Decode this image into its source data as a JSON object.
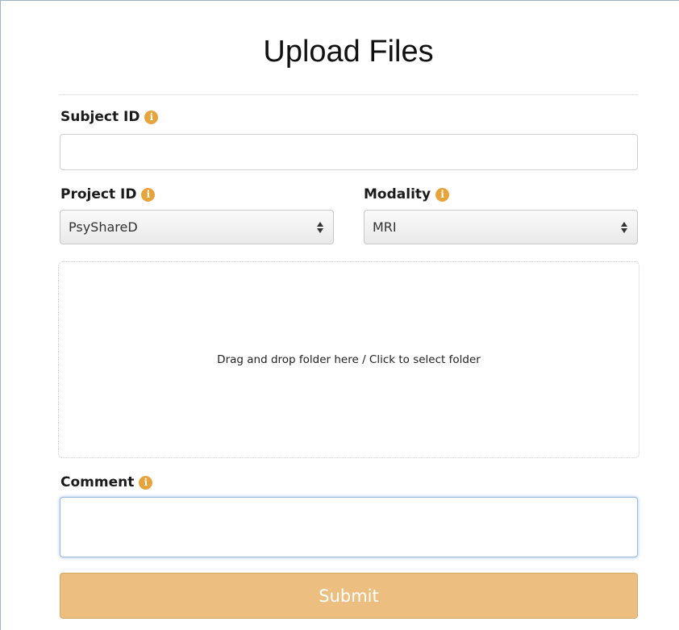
{
  "form": {
    "title": "Upload Files",
    "subject_id": {
      "label": "Subject ID",
      "value": ""
    },
    "project_id": {
      "label": "Project ID",
      "selected": "PsyShareD"
    },
    "modality": {
      "label": "Modality",
      "selected": "MRI"
    },
    "dropzone": {
      "text": "Drag and drop folder here / Click to select folder"
    },
    "comment": {
      "label": "Comment",
      "value": ""
    },
    "submit_label": "Submit"
  },
  "icons": {
    "info": "info-icon",
    "select_arrows": "updown-icon"
  },
  "colors": {
    "accent": "#e8a43c",
    "submit_bg": "#ecbf80",
    "focus_border": "#9ab8e6"
  }
}
